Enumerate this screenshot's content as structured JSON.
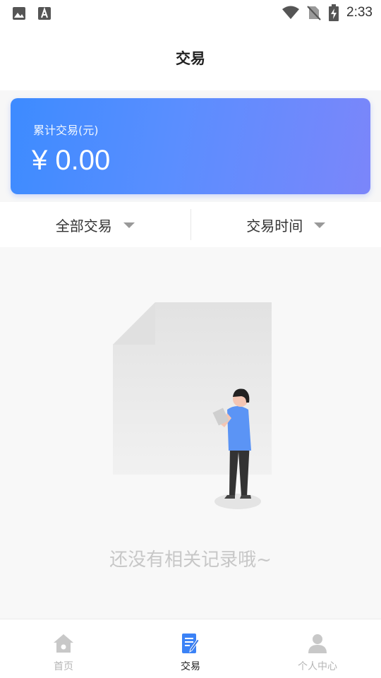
{
  "status_bar": {
    "time": "2:33",
    "left_icons": [
      "image-icon",
      "font-a-icon"
    ],
    "right_icons": [
      "wifi-icon",
      "no-sim-icon",
      "battery-charging-icon"
    ]
  },
  "header": {
    "title": "交易"
  },
  "summary": {
    "label": "累计交易(元)",
    "amount": "¥ 0.00"
  },
  "filters": [
    {
      "label": "全部交易",
      "icon": "caret-down-icon"
    },
    {
      "label": "交易时间",
      "icon": "caret-down-icon"
    }
  ],
  "empty_state": {
    "message": "还没有相关记录哦~",
    "illustration": "empty-document-person-illustration"
  },
  "bottom_nav": {
    "items": [
      {
        "label": "首页",
        "icon": "home-icon",
        "active": false
      },
      {
        "label": "交易",
        "icon": "document-edit-icon",
        "active": true
      },
      {
        "label": "个人中心",
        "icon": "person-icon",
        "active": false
      }
    ]
  },
  "colors": {
    "card_gradient_start": "#3d8bff",
    "card_gradient_end": "#7b86fa",
    "active_icon": "#3b82f6",
    "inactive": "#b5b5b5"
  }
}
